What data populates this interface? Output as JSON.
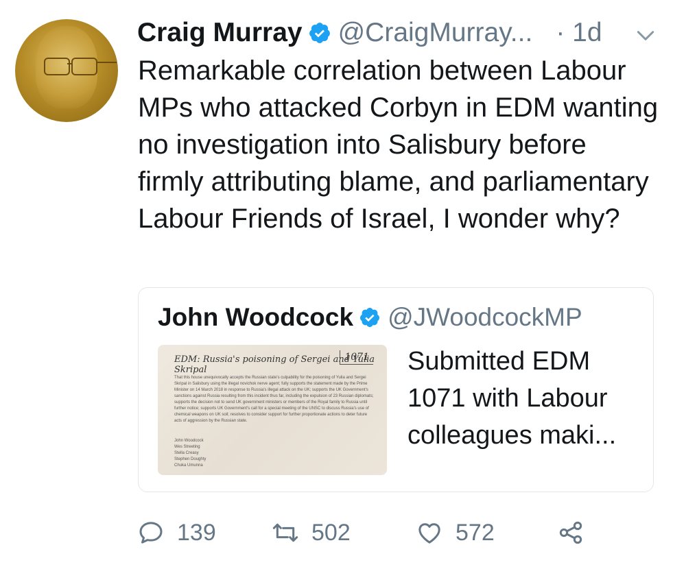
{
  "tweet": {
    "author_name": "Craig Murray",
    "author_handle": "@CraigMurray...",
    "time": "· 1d",
    "text": "Remarkable correlation between Labour MPs who attacked Corbyn in EDM wanting no investigation into Salisbury before firmly attributing blame, and parliamentary Labour Friends of Israel, I wonder why?"
  },
  "quoted_tweet": {
    "author_name": "John Woodcock",
    "author_handle": "@JWoodcockMP",
    "text": "Submitted EDM 1071 with Labour colleagues maki...",
    "image": {
      "handwritten_title": "EDM: Russia's poisoning of Sergei and Yulia Skripal",
      "edm_number": "1071",
      "body": "That this house unequivocally accepts the Russian state's culpability for the poisoning of Yulia and Sergei Skripal in Salisbury using the illegal novichok nerve agent; fully supports the statement made by the Prime Minister on 14 March 2018 in response to Russia's illegal attack on the UK; supports the UK Government's sanctions against Russia resulting from this incident thus far, including the expulsion of 23 Russian diplomats; supports the decision not to send UK government ministers or members of the Royal family to Russia until further notice; supports UK Government's call for a special meeting of the UNSC to discuss Russia's use of chemical weapons on UK soil; resolves to consider support for further proportionate actions to deter future acts of aggression by the Russian state.",
      "signatories": [
        "John Woodcock",
        "Wes Streeting",
        "Stella Creasy",
        "Stephen Doughty",
        "Chuka Umunna"
      ]
    }
  },
  "actions": {
    "reply_count": "139",
    "retweet_count": "502",
    "like_count": "572"
  },
  "colors": {
    "text": "#14171a",
    "secondary": "#657786",
    "verified": "#1da1f2",
    "border": "#e1e8ed"
  },
  "icons": [
    "verified-badge-icon",
    "chevron-down-icon",
    "reply-icon",
    "retweet-icon",
    "like-icon",
    "share-icon"
  ]
}
